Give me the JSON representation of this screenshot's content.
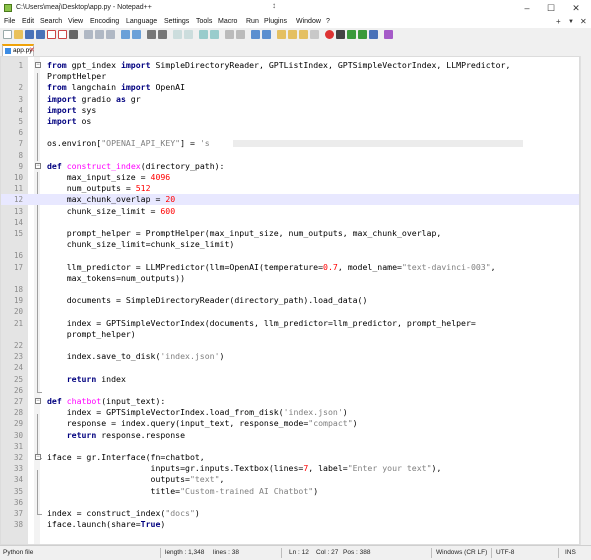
{
  "window": {
    "title": "C:\\Users\\meaj\\Desktop\\app.py - Notepad++"
  },
  "menu": [
    "File",
    "Edit",
    "Search",
    "View",
    "Encoding",
    "Language",
    "Settings",
    "Tools",
    "Macro",
    "Run",
    "Plugins",
    "Window",
    "?"
  ],
  "menu_right": {
    "add": "+",
    "dropdown": "▼",
    "close": "✕"
  },
  "tab": {
    "label": "app.py",
    "close": "✕"
  },
  "editor": {
    "current_line": 12,
    "lines": [
      {
        "n": "1",
        "fold": "open",
        "html": "<span class=\"kw\">from</span> gpt_index <span class=\"kw\">import</span> SimpleDirectoryReader, GPTListIndex, GPTSimpleVectorIndex, LLMPredictor,"
      },
      {
        "n": "",
        "html": "PromptHelper"
      },
      {
        "n": "2",
        "html": "<span class=\"kw\">from</span> langchain <span class=\"kw\">import</span> OpenAI"
      },
      {
        "n": "3",
        "html": "<span class=\"kw\">import</span> gradio <span class=\"kw\">as</span> gr"
      },
      {
        "n": "4",
        "html": "<span class=\"kw\">import</span> sys"
      },
      {
        "n": "5",
        "html": "<span class=\"kw\">import</span> os"
      },
      {
        "n": "6",
        "html": ""
      },
      {
        "n": "7",
        "html": "os.environ[<span class=\"str\">\"OPENAI_API_KEY\"</span>] = <span class=\"str\">'s</span>",
        "redact": true
      },
      {
        "n": "8",
        "html": ""
      },
      {
        "n": "9",
        "fold": "open",
        "html": "<span class=\"kw\">def</span> <span class=\"fn\">construct_index</span>(directory_path):"
      },
      {
        "n": "10",
        "html": "    max_input_size = <span class=\"num\">4096</span>"
      },
      {
        "n": "11",
        "html": "    num_outputs = <span class=\"num\">512</span>"
      },
      {
        "n": "12",
        "html": "    max_chunk_overlap = <span class=\"num\">20</span>"
      },
      {
        "n": "13",
        "html": "    chunk_size_limit = <span class=\"num\">600</span>"
      },
      {
        "n": "14",
        "html": ""
      },
      {
        "n": "15",
        "html": "    prompt_helper = PromptHelper(max_input_size, num_outputs, max_chunk_overlap,"
      },
      {
        "n": "",
        "html": "    chunk_size_limit=chunk_size_limit)"
      },
      {
        "n": "16",
        "html": ""
      },
      {
        "n": "17",
        "html": "    llm_predictor = LLMPredictor(llm=OpenAI(temperature=<span class=\"num\">0.7</span>, model_name=<span class=\"str\">\"text-davinci-003\"</span>,"
      },
      {
        "n": "",
        "html": "    max_tokens=num_outputs))"
      },
      {
        "n": "18",
        "html": ""
      },
      {
        "n": "19",
        "html": "    documents = SimpleDirectoryReader(directory_path).load_data()"
      },
      {
        "n": "20",
        "html": ""
      },
      {
        "n": "21",
        "html": "    index = GPTSimpleVectorIndex(documents, llm_predictor=llm_predictor, prompt_helper="
      },
      {
        "n": "",
        "html": "    prompt_helper)"
      },
      {
        "n": "22",
        "html": ""
      },
      {
        "n": "23",
        "html": "    index.save_to_disk(<span class=\"str\">'index.json'</span>)"
      },
      {
        "n": "24",
        "html": ""
      },
      {
        "n": "25",
        "html": "    <span class=\"kw\">return</span> index"
      },
      {
        "n": "26",
        "html": ""
      },
      {
        "n": "27",
        "fold": "open",
        "html": "<span class=\"kw\">def</span> <span class=\"fn\">chatbot</span>(input_text):"
      },
      {
        "n": "28",
        "html": "    index = GPTSimpleVectorIndex.load_from_disk(<span class=\"str\">'index.json'</span>)"
      },
      {
        "n": "29",
        "html": "    response = index.query(input_text, response_mode=<span class=\"str\">\"compact\"</span>)"
      },
      {
        "n": "30",
        "html": "    <span class=\"kw\">return</span> response.response"
      },
      {
        "n": "31",
        "html": ""
      },
      {
        "n": "32",
        "fold": "open",
        "html": "iface = gr.Interface(fn=chatbot,"
      },
      {
        "n": "33",
        "html": "                     inputs=gr.inputs.Textbox(lines=<span class=\"num\">7</span>, label=<span class=\"str\">\"Enter your text\"</span>),"
      },
      {
        "n": "34",
        "html": "                     outputs=<span class=\"str\">\"text\"</span>,"
      },
      {
        "n": "35",
        "html": "                     title=<span class=\"str\">\"Custom-trained AI Chatbot\"</span>)"
      },
      {
        "n": "36",
        "html": ""
      },
      {
        "n": "37",
        "html": "index = construct_index(<span class=\"str\">\"docs\"</span>)"
      },
      {
        "n": "38",
        "html": "iface.launch(share=<span class=\"kw\">True</span>)"
      }
    ]
  },
  "status": {
    "file_type": "Python file",
    "length": "length : 1,348",
    "lines": "lines : 38",
    "ln": "Ln : 12",
    "col": "Col : 27",
    "pos": "Pos : 388",
    "eol": "Windows (CR LF)",
    "encoding": "UTF-8",
    "mode": "INS"
  },
  "colors": {
    "keyword": "#00007f",
    "function": "#ff00ff",
    "string": "#808080",
    "number": "#ff0000",
    "current_line": "#e8e8ff",
    "tab_accent": "#f0a30a"
  }
}
